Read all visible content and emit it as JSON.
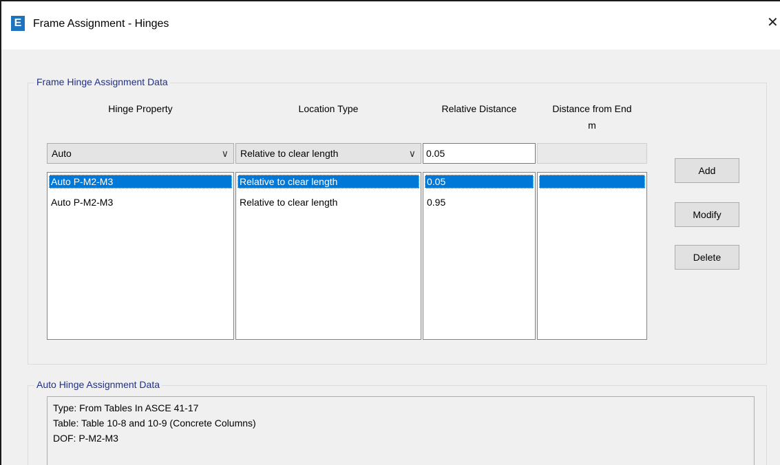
{
  "window": {
    "app_icon_letter": "E",
    "title": "Frame Assignment - Hinges",
    "close_glyph": "✕"
  },
  "frame_hinge": {
    "group_title": "Frame Hinge Assignment Data",
    "columns": {
      "hinge_property": "Hinge Property",
      "location_type": "Location Type",
      "relative_distance": "Relative Distance",
      "distance_from_end": "Distance from End",
      "distance_unit": "m"
    },
    "inputs": {
      "hinge_property_value": "Auto",
      "location_type_value": "Relative to clear length",
      "relative_distance_value": "0.05",
      "distance_from_end_value": ""
    },
    "rows": [
      {
        "hinge_property": "Auto  P-M2-M3",
        "location_type": "Relative to clear length",
        "relative_distance": "0.05",
        "distance_from_end": ""
      },
      {
        "hinge_property": "Auto  P-M2-M3",
        "location_type": "Relative to clear length",
        "relative_distance": "0.95",
        "distance_from_end": ""
      }
    ],
    "selected_row": 0,
    "buttons": {
      "add": "Add",
      "modify": "Modify",
      "delete": "Delete"
    }
  },
  "auto_hinge": {
    "group_title": "Auto Hinge Assignment Data",
    "lines": [
      "Type:  From Tables In ASCE 41-17",
      "Table:  Table 10-8 and 10-9 (Concrete Columns)",
      "DOF:  P-M2-M3"
    ]
  },
  "icons": {
    "dropdown_chevron": "∨",
    "app_icon": "etabs-app-icon"
  },
  "colors": {
    "selection": "#0078d7",
    "group_title_text": "#1f2f8a",
    "dialog_background": "#f0f0f0"
  }
}
